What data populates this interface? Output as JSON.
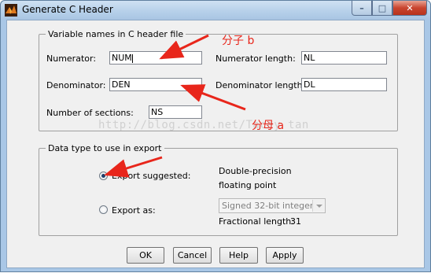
{
  "window": {
    "title": "Generate C Header",
    "controls": {
      "minimize": "–",
      "maximize": "□",
      "close": "✕"
    }
  },
  "variable_names": {
    "legend": "Variable names in C header file",
    "numerator": {
      "label": "Numerator:",
      "value": "NUM"
    },
    "numerator_length": {
      "label": "Numerator length:",
      "value": "NL"
    },
    "denominator": {
      "label": "Denominator:",
      "value": "DEN"
    },
    "denominator_length": {
      "label": "Denominator length:",
      "value": "DL"
    },
    "num_sections": {
      "label": "Number of sections:",
      "value": "NS"
    }
  },
  "data_type": {
    "legend": "Data type to use in export",
    "export_suggested": {
      "label": "Export suggested:",
      "checked": true
    },
    "suggested_type_line1": "Double-precision",
    "suggested_type_line2": "floating point",
    "export_as": {
      "label": "Export as:",
      "checked": false
    },
    "export_as_select": "Signed 32-bit integer",
    "fractional_length_label": "Fractional length:",
    "fractional_length_value": "31"
  },
  "buttons": {
    "ok": "OK",
    "cancel": "Cancel",
    "help": "Help",
    "apply": "Apply"
  },
  "annotations": {
    "numerator_note": "分子 b",
    "denominator_note": "分母 a",
    "color": "#e8261b"
  },
  "watermark": "http://blog.csdn.net/Tacey_tan"
}
